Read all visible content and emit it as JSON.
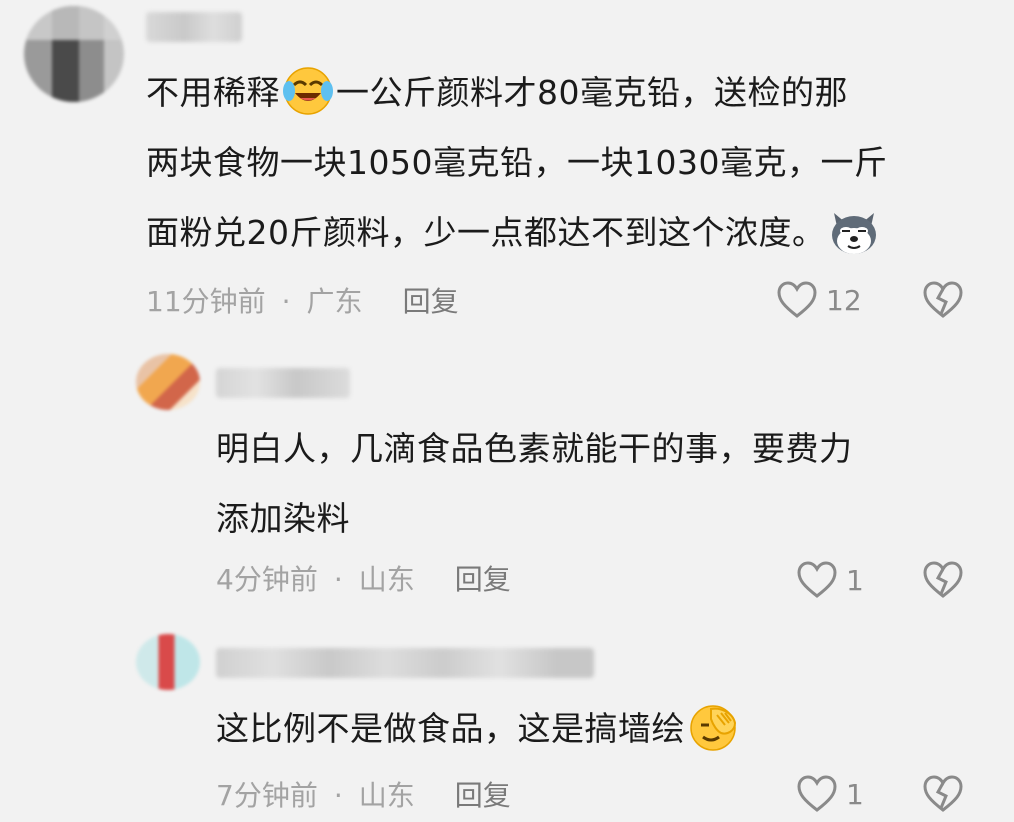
{
  "comments": [
    {
      "lines": [
        [
          "不用稀释",
          "laugh-cry-emoji",
          "一公斤颜料才80毫克铅，送检的那"
        ],
        [
          "两块食物一块1050毫克铅，一块1030毫克，一斤"
        ],
        [
          "面粉兑20斤颜料，少一点都达不到这个浓度。",
          "dog-emoji"
        ]
      ],
      "time": "11分钟前",
      "separator": "·",
      "location": "广东",
      "reply": "回复",
      "likes": "12"
    },
    {
      "lines": [
        [
          "明白人，几滴食品色素就能干的事，要费力"
        ],
        [
          "添加染料"
        ]
      ],
      "time": "4分钟前",
      "separator": "·",
      "location": "山东",
      "reply": "回复",
      "likes": "1"
    },
    {
      "lines": [
        [
          "这比例不是做食品，这是搞墙绘",
          "facepalm-emoji"
        ]
      ],
      "time": "7分钟前",
      "separator": "·",
      "location": "山东",
      "reply": "回复",
      "likes": "1"
    }
  ]
}
